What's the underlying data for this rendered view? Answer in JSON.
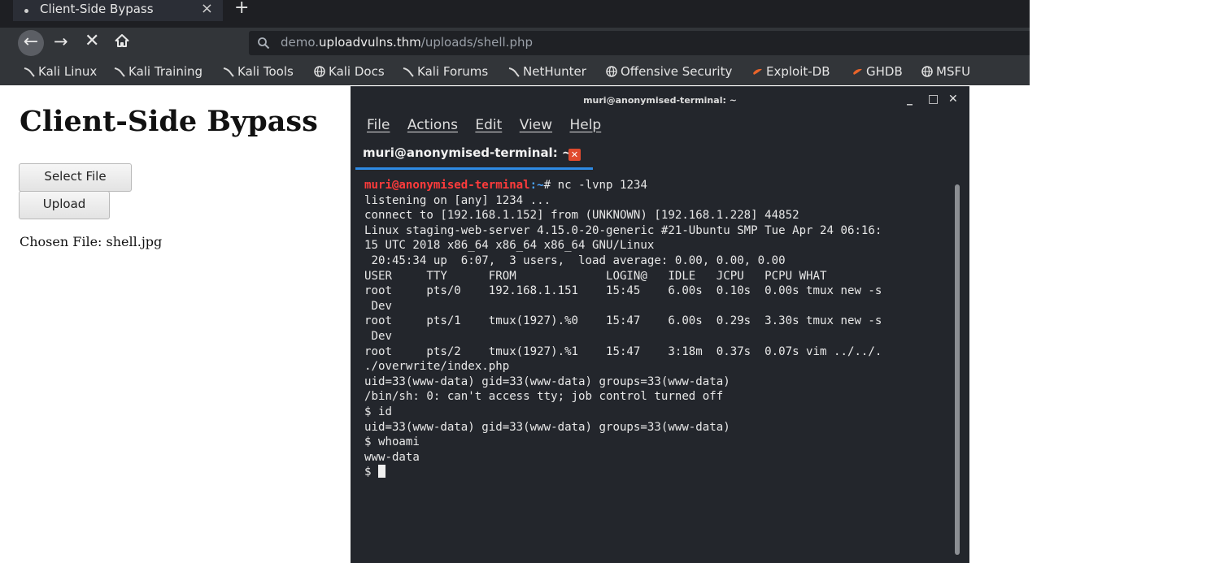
{
  "browser": {
    "tab": {
      "title": "Client-Side Bypass",
      "close": "×"
    },
    "new_tab": "+",
    "nav": {
      "back": "←",
      "forward": "→",
      "stop": "✕"
    },
    "url": {
      "pre": "demo.",
      "host": "uploadvulns.thm",
      "path": "/uploads/shell.php"
    },
    "bookmarks": [
      {
        "label": "Kali Linux",
        "icon": "kali-dragon-icon"
      },
      {
        "label": "Kali Training",
        "icon": "kali-dragon-icon"
      },
      {
        "label": "Kali Tools",
        "icon": "kali-dragon-icon"
      },
      {
        "label": "Kali Docs",
        "icon": "globe-icon"
      },
      {
        "label": "Kali Forums",
        "icon": "kali-dragon-icon"
      },
      {
        "label": "NetHunter",
        "icon": "kali-dragon-icon"
      },
      {
        "label": "Offensive Security",
        "icon": "globe-icon"
      },
      {
        "label": "Exploit-DB",
        "icon": "exploit-db-icon"
      },
      {
        "label": "GHDB",
        "icon": "exploit-db-icon"
      },
      {
        "label": "MSFU",
        "icon": "globe-icon"
      }
    ]
  },
  "page": {
    "heading": "Client-Side Bypass",
    "select_button": "Select File",
    "upload_button": "Upload",
    "chosen_file": "Chosen File: shell.jpg"
  },
  "terminal": {
    "window_title": "muri@anonymised-terminal: ~",
    "controls": {
      "minimize": "_",
      "maximize": "□",
      "close": "✕"
    },
    "menu": [
      "File",
      "Actions",
      "Edit",
      "View",
      "Help"
    ],
    "tab_label": "muri@anonymised-terminal: ~",
    "prompt": {
      "user_host": "muri@anonymised-terminal",
      "sep": ":",
      "path": "~",
      "symbol": "# ",
      "command": "nc -lvnp 1234"
    },
    "output": [
      "listening on [any] 1234 ...",
      "connect to [192.168.1.152] from (UNKNOWN) [192.168.1.228] 44852",
      "Linux staging-web-server 4.15.0-20-generic #21-Ubuntu SMP Tue Apr 24 06:16:",
      "15 UTC 2018 x86_64 x86_64 x86_64 GNU/Linux",
      " 20:45:34 up  6:07,  3 users,  load average: 0.00, 0.00, 0.00",
      "USER     TTY      FROM             LOGIN@   IDLE   JCPU   PCPU WHAT",
      "root     pts/0    192.168.1.151    15:45    6.00s  0.10s  0.00s tmux new -s",
      " Dev",
      "root     pts/1    tmux(1927).%0    15:47    6.00s  0.29s  3.30s tmux new -s",
      " Dev",
      "root     pts/2    tmux(1927).%1    15:47    3:18m  0.37s  0.07s vim ../../.",
      "./overwrite/index.php",
      "uid=33(www-data) gid=33(www-data) groups=33(www-data)",
      "/bin/sh: 0: can't access tty; job control turned off",
      "$ id",
      "uid=33(www-data) gid=33(www-data) groups=33(www-data)",
      "$ whoami",
      "www-data"
    ],
    "final_prompt": "$ "
  }
}
